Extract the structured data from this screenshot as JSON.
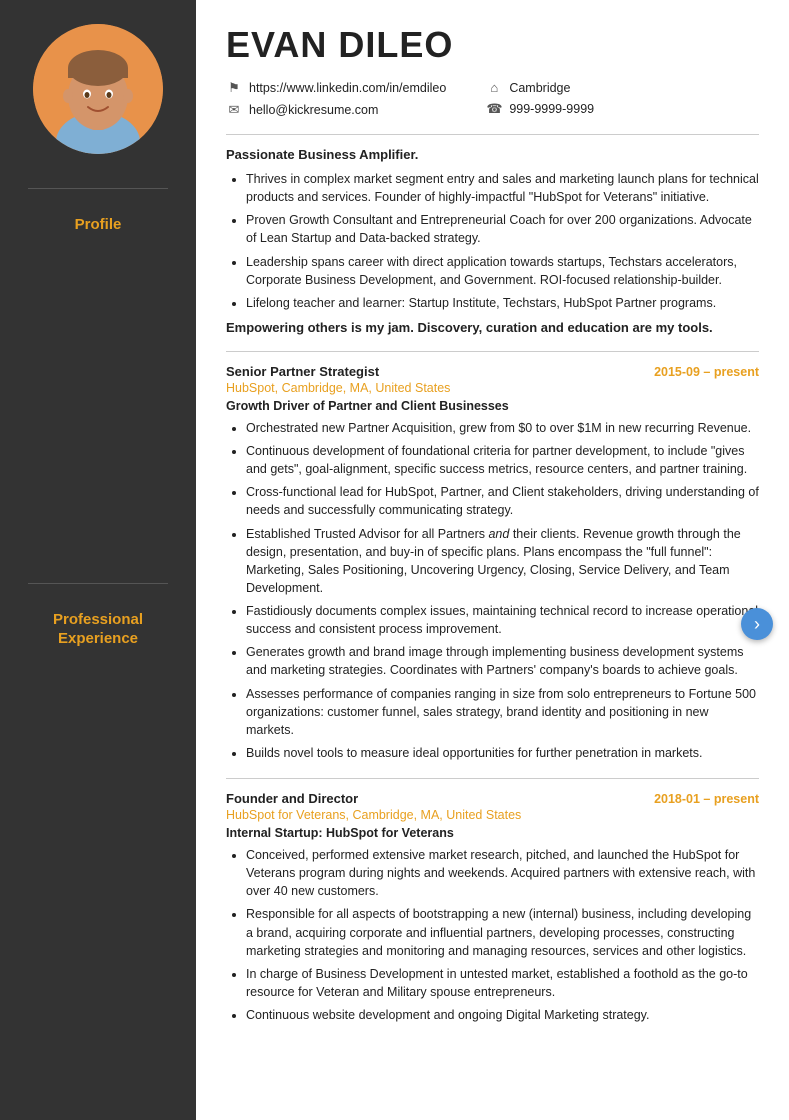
{
  "sidebar": {
    "section_profile": "Profile",
    "section_experience": "Professional\nExperience"
  },
  "header": {
    "name": "EVAN DILEO",
    "linkedin": "https://www.linkedin.com/in/emdileo",
    "email": "hello@kickresume.com",
    "city": "Cambridge",
    "phone": "999-9999-9999"
  },
  "profile": {
    "intro": "Passionate Business Amplifier.",
    "bullets": [
      "Thrives in complex market segment entry and sales and marketing launch plans for technical products and services.  Founder of highly-impactful \"HubSpot for Veterans\" initiative.",
      "Proven Growth Consultant and Entrepreneurial Coach for over 200 organizations. Advocate of Lean Startup and Data-backed strategy.",
      "Leadership spans career with direct application towards startups, Techstars accelerators, Corporate Business Development, and Government. ROI-focused relationship-builder.",
      "Lifelong teacher and learner:  Startup Institute, Techstars, HubSpot Partner programs."
    ],
    "tagline": "Empowering others is my jam.  Discovery, curation and education are my tools."
  },
  "experience": [
    {
      "title": "Senior Partner Strategist",
      "date": "2015-09 – present",
      "company": "HubSpot, Cambridge, MA, United States",
      "subtitle": "Growth Driver of Partner and Client Businesses",
      "bullets": [
        "Orchestrated new Partner Acquisition, grew from $0 to over $1M in new recurring Revenue.",
        "Continuous development of foundational criteria for partner development, to include \"gives and gets\", goal-alignment, specific success metrics, resource centers, and partner training.",
        "Cross-functional lead for HubSpot, Partner, and Client stakeholders, driving understanding of needs and successfully communicating strategy.",
        "Established Trusted Advisor for all Partners and their clients. Revenue growth through the design, presentation, and buy-in of specific plans.  Plans encompass the \"full funnel\": Marketing, Sales Positioning, Uncovering Urgency, Closing, Service Delivery, and Team Development.",
        "Fastidiously documents complex issues, maintaining technical record to increase operational success and consistent process improvement.",
        "Generates growth and brand image through implementing business development systems and marketing strategies.  Coordinates with Partners' company's boards to achieve goals.",
        "Assesses performance of companies ranging in size from solo entrepreneurs to Fortune 500 organizations: customer funnel, sales strategy, brand identity and positioning in new markets.",
        "Builds novel tools to measure ideal opportunities for further penetration in markets."
      ]
    },
    {
      "title": "Founder and Director",
      "date": "2018-01 – present",
      "company": "HubSpot for Veterans, Cambridge, MA, United States",
      "subtitle": "Internal Startup: HubSpot for Veterans",
      "bullets": [
        "Conceived, performed extensive market research, pitched, and launched the HubSpot for Veterans program during nights and weekends.  Acquired partners with extensive reach, with over 40 new customers.",
        "Responsible for all aspects of bootstrapping a new (internal) business, including developing a brand, acquiring corporate and influential partners, developing processes, constructing marketing strategies and monitoring and managing resources, services and other logistics.",
        "In charge of Business Development in untested market, established a foothold as the go-to resource for Veteran and Military spouse entrepreneurs.",
        "Continuous website development and ongoing Digital Marketing strategy."
      ]
    }
  ]
}
